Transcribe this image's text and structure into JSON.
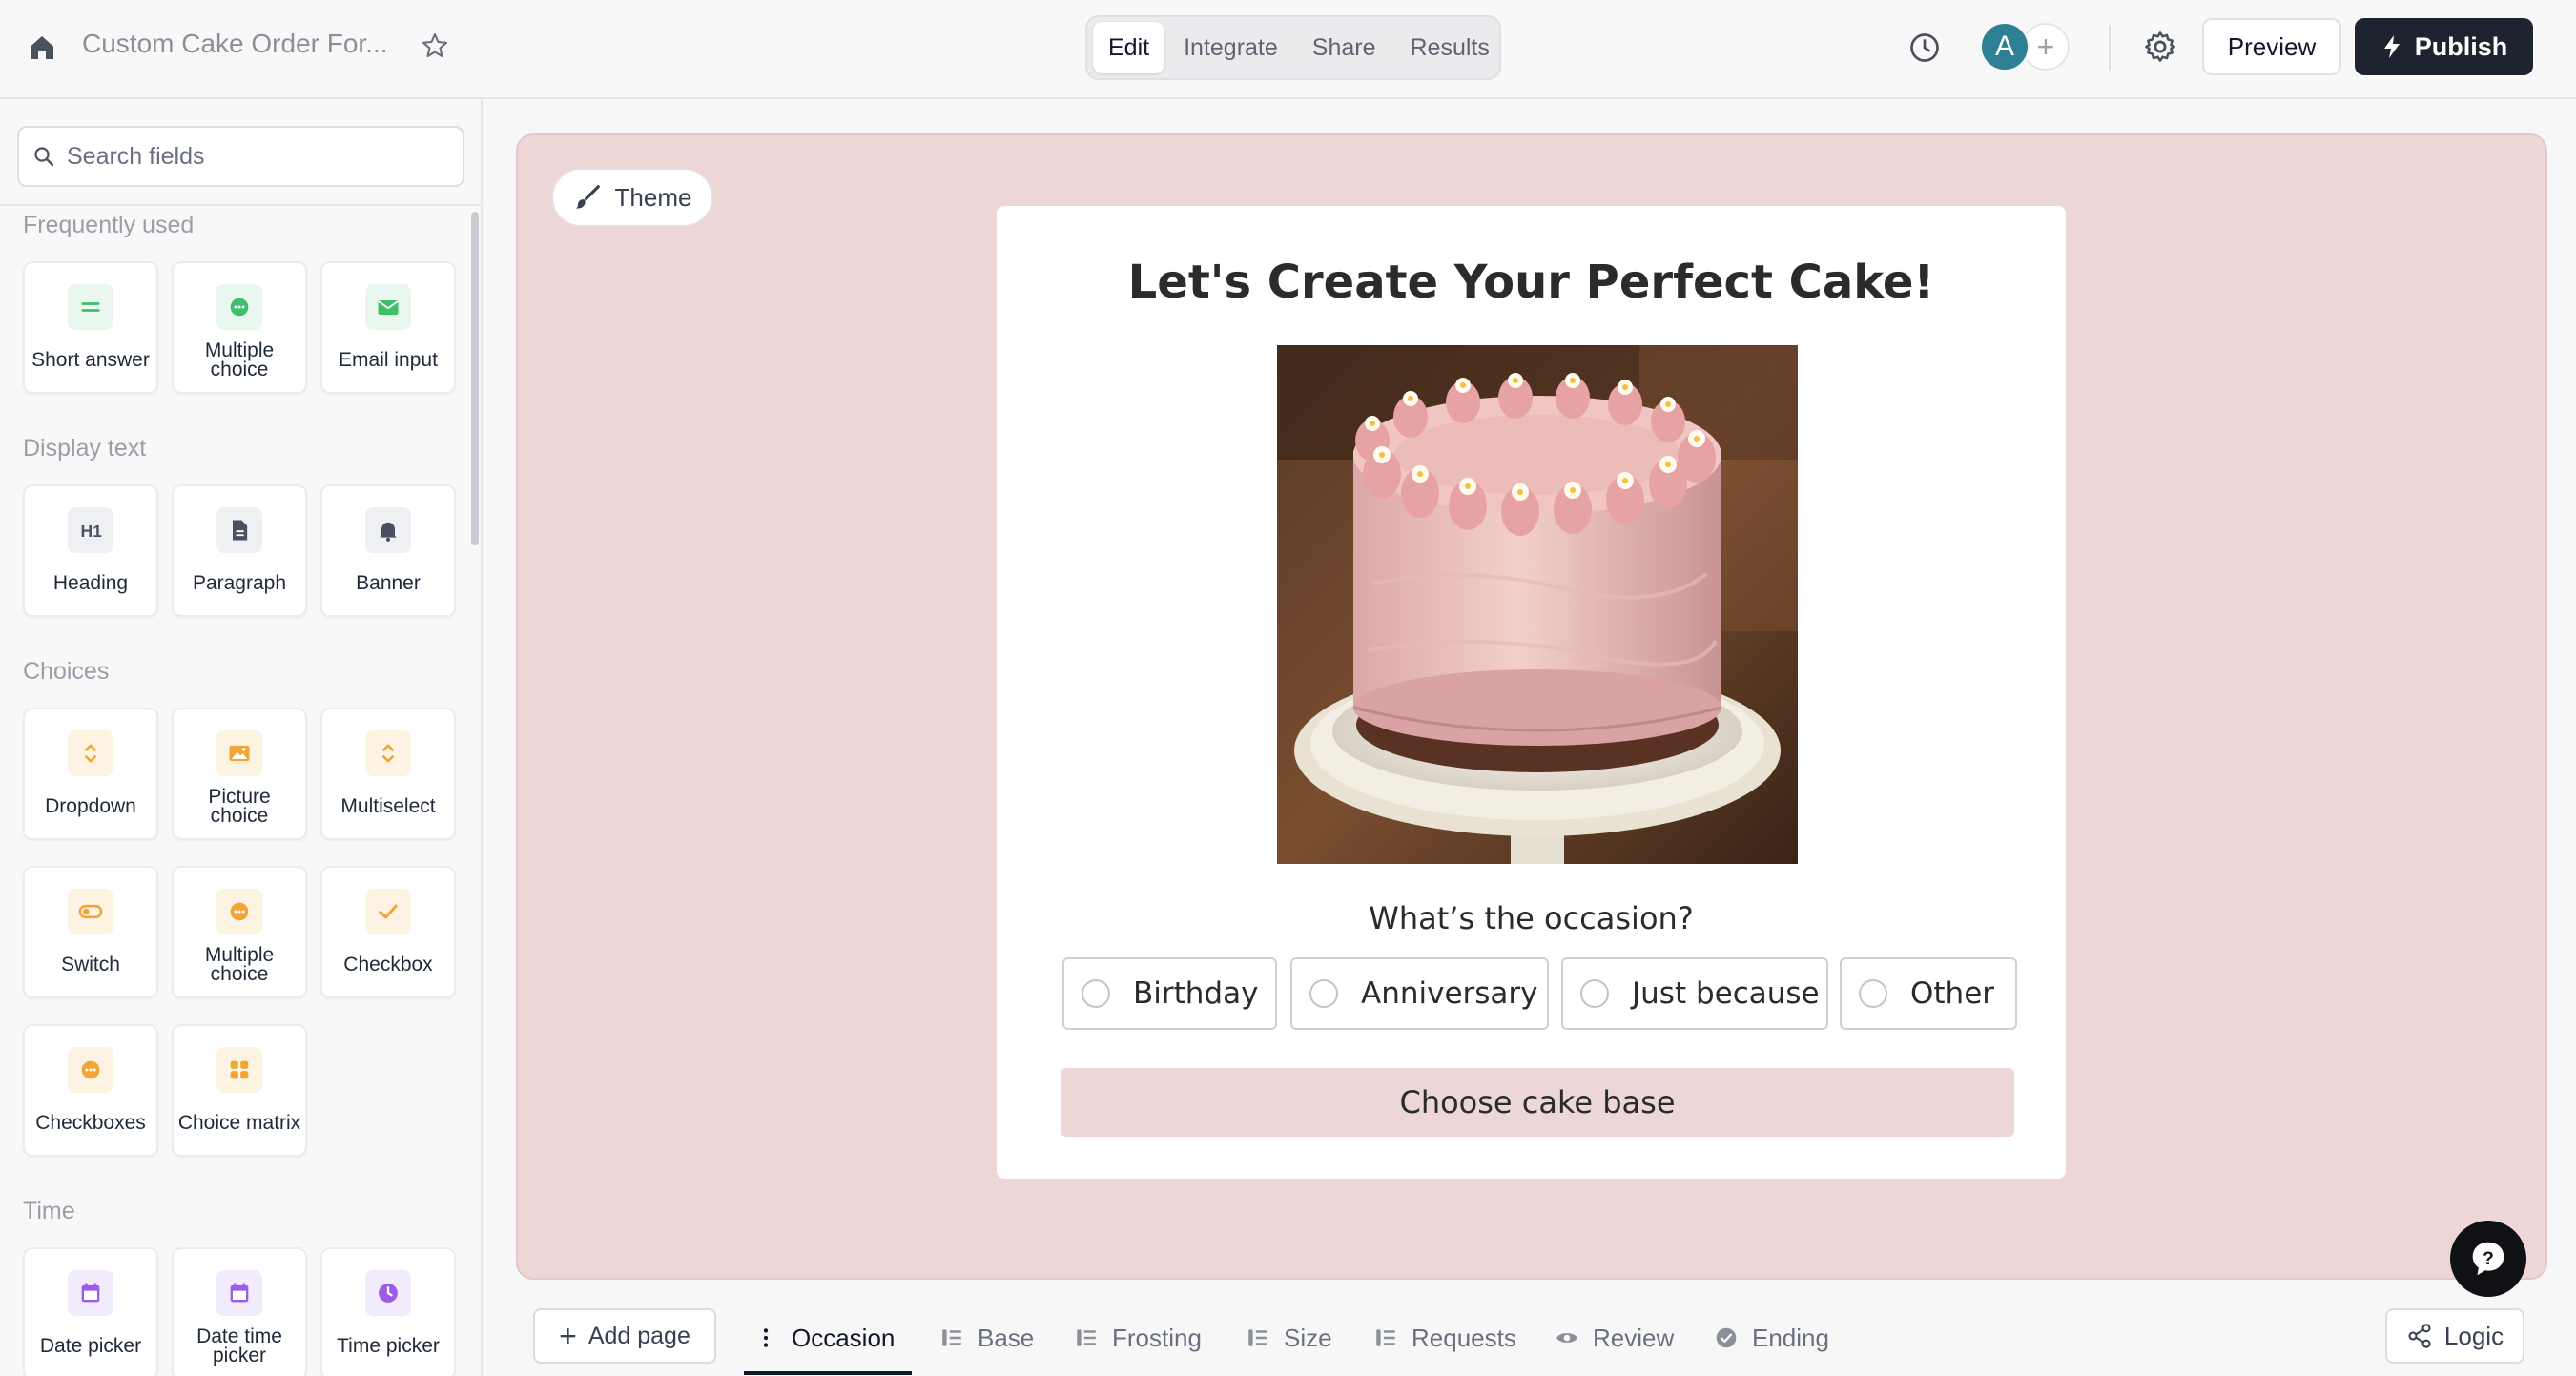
{
  "header": {
    "form_title": "Custom Cake Order For...",
    "mode_tabs": [
      "Edit",
      "Integrate",
      "Share",
      "Results"
    ],
    "active_mode": "Edit",
    "avatar_initial": "A",
    "preview_label": "Preview",
    "publish_label": "Publish"
  },
  "sidebar": {
    "search_placeholder": "Search fields",
    "sections": [
      {
        "label": "Frequently used",
        "items": [
          "Short answer",
          "Multiple choice",
          "Email input"
        ]
      },
      {
        "label": "Display text",
        "items": [
          "Heading",
          "Paragraph",
          "Banner"
        ]
      },
      {
        "label": "Choices",
        "items": [
          "Dropdown",
          "Picture choice",
          "Multiselect",
          "Switch",
          "Multiple choice",
          "Checkbox",
          "Checkboxes",
          "Choice matrix"
        ]
      },
      {
        "label": "Time",
        "items": [
          "Date picker",
          "Date time picker",
          "Time picker"
        ]
      }
    ]
  },
  "canvas": {
    "theme_label": "Theme",
    "heading": "Let's Create Your Perfect Cake!",
    "question": "What’s the occasion?",
    "options": [
      "Birthday",
      "Anniversary",
      "Just because",
      "Other"
    ],
    "next_button": "Choose cake base",
    "background_color": "#ecd6d6"
  },
  "footer": {
    "add_page_label": "Add page",
    "pages": [
      "Occasion",
      "Base",
      "Frosting",
      "Size",
      "Requests",
      "Review",
      "Ending"
    ],
    "active_page": "Occasion",
    "logic_label": "Logic"
  },
  "colors": {
    "publish_bg": "#1d2430",
    "accent_green": "#3fbf6b",
    "accent_orange": "#f0a535",
    "accent_purple": "#9b5de5"
  }
}
